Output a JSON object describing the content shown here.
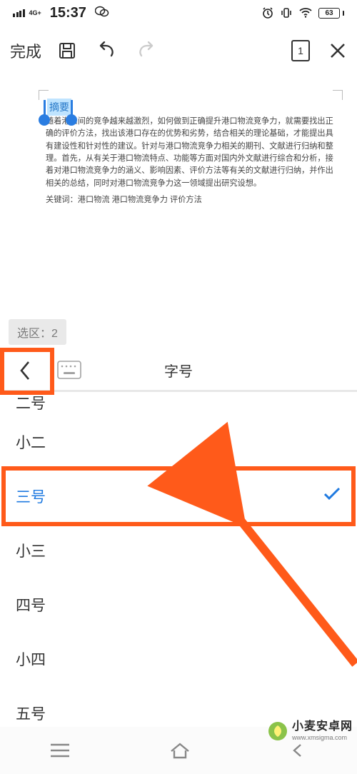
{
  "status": {
    "net": "4G+",
    "time": "15:37",
    "battery": "63"
  },
  "toolbar": {
    "done": "完成",
    "page_num": "1"
  },
  "document": {
    "title": "摘要",
    "body": "随着港口间的竞争越来越激烈，如何做到正确提升港口物流竞争力，就需要找出正确的评价方法，找出该港口存在的优势和劣势，结合相关的理论基础，才能提出具有建设性和针对性的建议。针对与港口物流竞争力相关的期刊、文献进行归纳和整理。首先，从有关于港口物流特点、功能等方面对国内外文献进行综合和分析，接着对港口物流竞争力的涵义、影响因素、评价方法等有关的文献进行归纳，并作出相关的总结，同时对港口物流竞争力这一领域提出研究设想。",
    "keywords_label": "关键词：",
    "keywords": "港口物流  港口物流竞争力   评价方法"
  },
  "selection_badge": "选区：2",
  "panel": {
    "title": "字号"
  },
  "sizes": [
    "二号",
    "小二",
    "三号",
    "小三",
    "四号",
    "小四",
    "五号"
  ],
  "selected_index": 2,
  "watermark": {
    "cn": "小麦安卓网",
    "en": "www.xmsigma.com"
  }
}
